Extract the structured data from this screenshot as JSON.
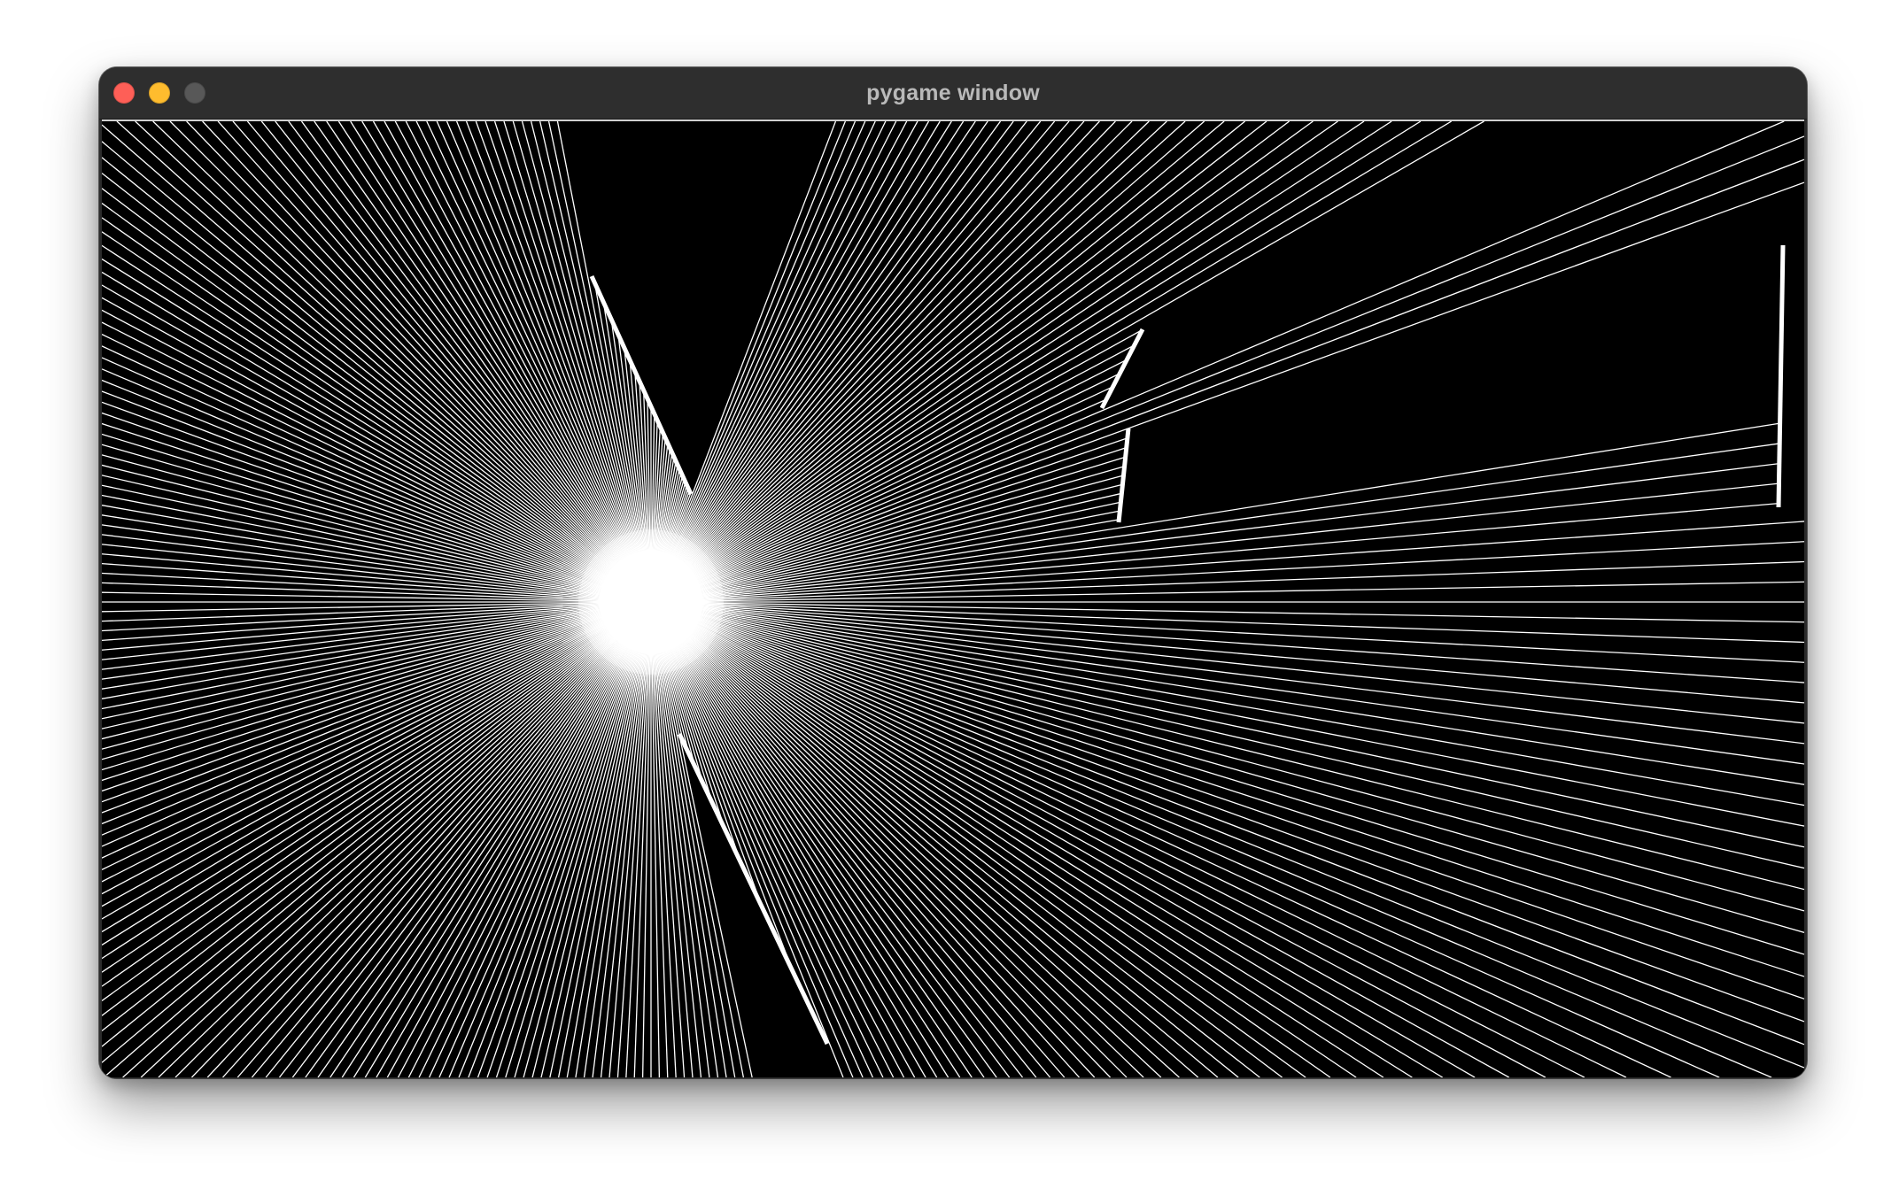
{
  "window": {
    "title": "pygame window",
    "buttons": {
      "close_color": "#fe5f57",
      "minimize_color": "#febc2e",
      "maximize_color": "#585858"
    }
  },
  "scene": {
    "background_color": "#000000",
    "ray_color": "#ffffff",
    "wall_color": "#ffffff",
    "description_icon": "raycast-light-source",
    "ray_count": 360
  }
}
